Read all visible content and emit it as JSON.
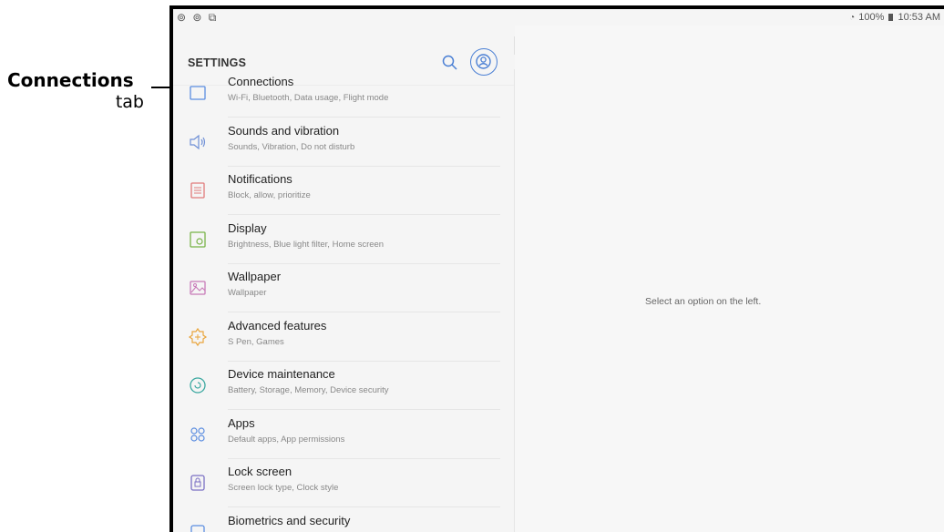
{
  "annotation": {
    "title": "Connections",
    "subtitle": "tab"
  },
  "status_bar": {
    "left_icons": "⊚ ⊚ ⧉",
    "right_text": "100%",
    "time": "10:53 AM"
  },
  "header": {
    "title": "SETTINGS",
    "search_icon": "search-icon",
    "account_icon": "account-icon"
  },
  "detail": {
    "empty_message": "Select an option on the left."
  },
  "menu": [
    {
      "title": "Connections",
      "subtitle": "Wi-Fi, Bluetooth, Data usage, Flight mode",
      "icon": "connections-icon",
      "color": "#5b8de0"
    },
    {
      "title": "Sounds and vibration",
      "subtitle": "Sounds, Vibration, Do not disturb",
      "icon": "speaker-icon",
      "color": "#6e8fd6"
    },
    {
      "title": "Notifications",
      "subtitle": "Block, allow, prioritize",
      "icon": "notifications-icon",
      "color": "#e07a7a"
    },
    {
      "title": "Display",
      "subtitle": "Brightness, Blue light filter, Home screen",
      "icon": "display-icon",
      "color": "#78b347"
    },
    {
      "title": "Wallpaper",
      "subtitle": "Wallpaper",
      "icon": "wallpaper-icon",
      "color": "#c87ab8"
    },
    {
      "title": "Advanced features",
      "subtitle": "S Pen, Games",
      "icon": "advanced-features-icon",
      "color": "#e9a53c"
    },
    {
      "title": "Device maintenance",
      "subtitle": "Battery, Storage, Memory, Device security",
      "icon": "device-maintenance-icon",
      "color": "#3ba8a0"
    },
    {
      "title": "Apps",
      "subtitle": "Default apps, App permissions",
      "icon": "apps-icon",
      "color": "#5b8de0"
    },
    {
      "title": "Lock screen",
      "subtitle": "Screen lock type, Clock style",
      "icon": "lock-screen-icon",
      "color": "#7a6fc4"
    },
    {
      "title": "Biometrics and security",
      "subtitle": "",
      "icon": "biometrics-icon",
      "color": "#5b8de0"
    }
  ]
}
